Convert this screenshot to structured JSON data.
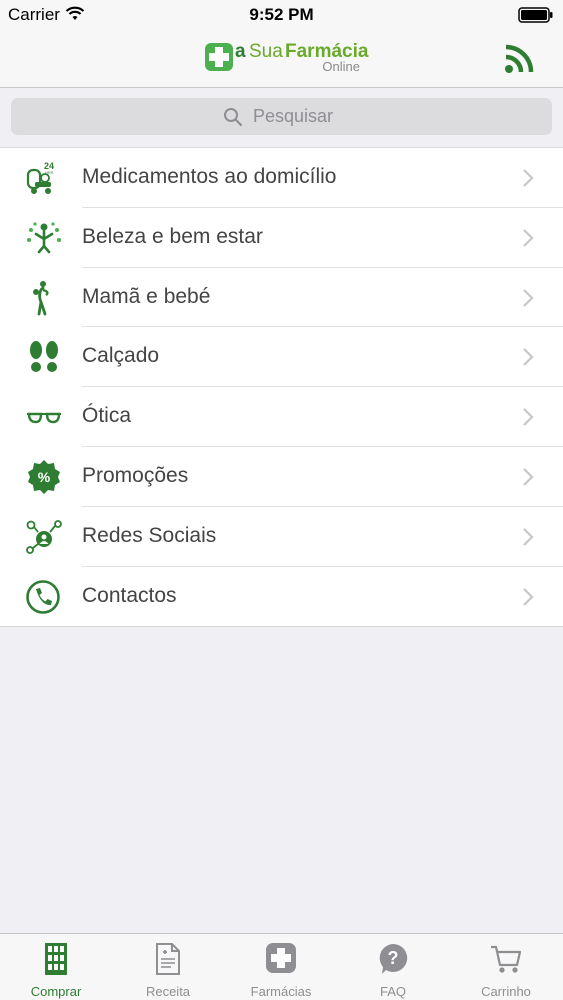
{
  "status_bar": {
    "carrier": "Carrier",
    "time": "9:52 PM"
  },
  "header": {
    "logo": {
      "a": "a",
      "sua": "Sua",
      "farmacia": "Farmácia",
      "online": "Online"
    },
    "right_icon": "rss-icon"
  },
  "search": {
    "placeholder": "Pesquisar"
  },
  "menu": {
    "items": [
      {
        "label": "Medicamentos ao domicílio",
        "icon": "delivery-24hrs-icon"
      },
      {
        "label": "Beleza e bem estar",
        "icon": "beauty-wellness-icon"
      },
      {
        "label": "Mamã e bebé",
        "icon": "mother-baby-icon"
      },
      {
        "label": "Calçado",
        "icon": "footprints-icon"
      },
      {
        "label": "Ótica",
        "icon": "glasses-icon"
      },
      {
        "label": "Promoções",
        "icon": "percent-badge-icon"
      },
      {
        "label": "Redes Sociais",
        "icon": "social-network-icon"
      },
      {
        "label": "Contactos",
        "icon": "phone-icon"
      }
    ]
  },
  "tabs": [
    {
      "label": "Comprar",
      "active": true
    },
    {
      "label": "Receita",
      "active": false
    },
    {
      "label": "Farmácias",
      "active": false
    },
    {
      "label": "FAQ",
      "active": false
    },
    {
      "label": "Carrinho",
      "active": false
    }
  ],
  "colors": {
    "accent": "#2e7d32",
    "brand_light": "#6aaa2a",
    "inactive": "#8e8e93"
  }
}
